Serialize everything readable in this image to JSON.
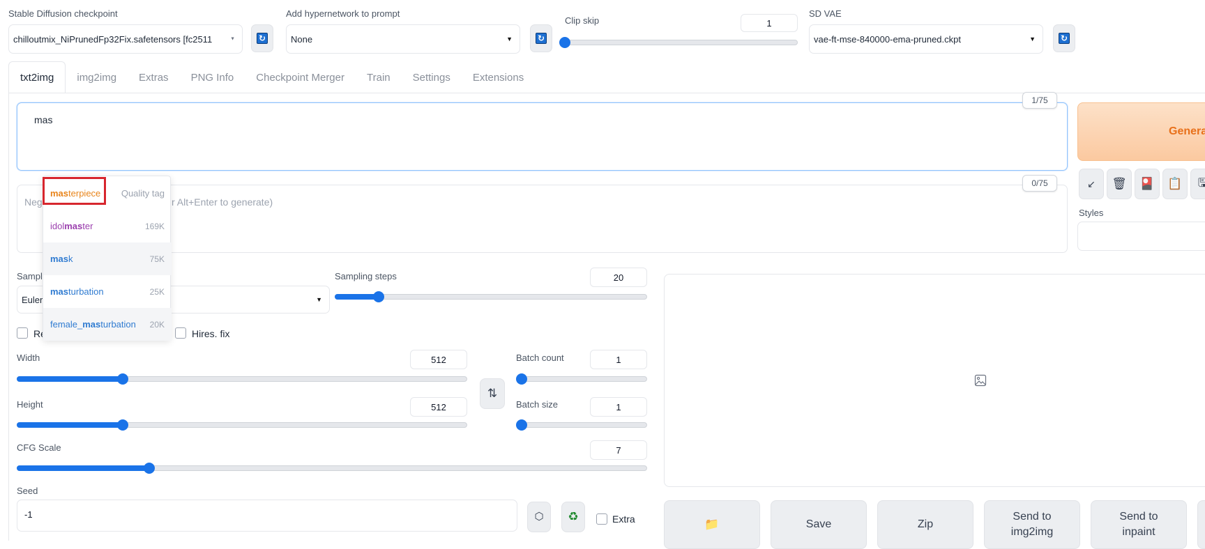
{
  "top": {
    "checkpoint_label": "Stable Diffusion checkpoint",
    "checkpoint_value": "chilloutmix_NiPrunedFp32Fix.safetensors [fc2511",
    "hypernetwork_label": "Add hypernetwork to prompt",
    "hypernetwork_value": "None",
    "clip_skip_label": "Clip skip",
    "clip_skip_value": "1",
    "vae_label": "SD VAE",
    "vae_value": "vae-ft-mse-840000-ema-pruned.ckpt"
  },
  "tabs": [
    "txt2img",
    "img2img",
    "Extras",
    "PNG Info",
    "Checkpoint Merger",
    "Train",
    "Settings",
    "Extensions"
  ],
  "prompt": {
    "value": "mas",
    "counter": "1/75",
    "negative_placeholder_visible": "Neg",
    "negative_placeholder_tail": "r Alt+Enter to generate)",
    "negative_counter": "0/75"
  },
  "autocomplete": {
    "items": [
      {
        "match": "mas",
        "rest": "terpiece",
        "right": "Quality tag",
        "color": "#e8841a"
      },
      {
        "pre": "idol",
        "match": "mas",
        "rest": "ter",
        "right": "169K",
        "color": "#9b3fae"
      },
      {
        "match": "mas",
        "rest": "k",
        "right": "75K",
        "color": "#2f7bd1"
      },
      {
        "match": "mas",
        "rest": "turbation",
        "right": "25K",
        "color": "#2f7bd1"
      },
      {
        "pre": "female_",
        "match": "mas",
        "rest": "turbation",
        "right": "20K",
        "color": "#2f7bd1"
      }
    ]
  },
  "sampling": {
    "method_label_visible": "Sampl",
    "method_value_visible": "Euler",
    "steps_label": "Sampling steps",
    "steps_value": "20",
    "steps_fraction": 0.14
  },
  "options": {
    "restore_visible": "Re",
    "hires_label": "Hires. fix"
  },
  "size": {
    "width_label": "Width",
    "width_value": "512",
    "width_fraction": 0.235,
    "height_label": "Height",
    "height_value": "512",
    "height_fraction": 0.235,
    "swap_icon": "swap-vertical-icon"
  },
  "batch": {
    "count_label": "Batch count",
    "count_value": "1",
    "count_fraction": 0.0,
    "size_label": "Batch size",
    "size_value": "1",
    "size_fraction": 0.0
  },
  "cfg": {
    "label": "CFG Scale",
    "value": "7",
    "fraction": 0.21
  },
  "seed": {
    "label": "Seed",
    "value": "-1",
    "extra_label": "Extra"
  },
  "generate": {
    "label_visible": "Genera",
    "styles_label": "Styles"
  },
  "output_buttons": [
    {
      "label": "",
      "icon": "folder-icon"
    },
    {
      "label": "Save"
    },
    {
      "label": "Zip"
    },
    {
      "label": "Send to\nimg2img"
    },
    {
      "label": "Send to\ninpaint"
    }
  ],
  "colors": {
    "accent": "#1a73e8",
    "generate_bg": "#fcd3ae",
    "generate_text": "#e8701a",
    "highlight_box": "#d7262e"
  }
}
